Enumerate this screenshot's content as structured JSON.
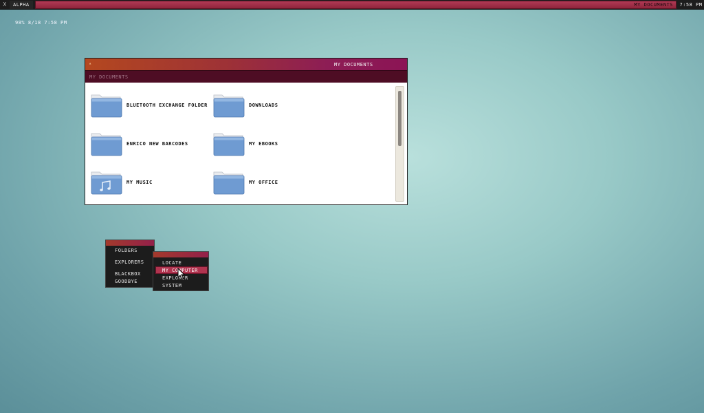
{
  "panel": {
    "close_glyph": "x",
    "workspace": "ALPHA",
    "active_task": "MY DOCUMENTS",
    "clock": "7:58 PM"
  },
  "desktop": {
    "status": "98% 8/18  7:58 pm"
  },
  "window": {
    "title": "MY DOCUMENTS",
    "button_glyph": "▴",
    "address": "MY DOCUMENTS",
    "items": [
      {
        "label": "BLUETOOTH EXCHANGE FOLDER",
        "icon": "folder-icon"
      },
      {
        "label": "DOWNLOADS",
        "icon": "folder-icon"
      },
      {
        "label": "ENRICO NEW BARCODES",
        "icon": "folder-icon"
      },
      {
        "label": "MY EBOOKS",
        "icon": "folder-icon"
      },
      {
        "label": "MY MUSIC",
        "icon": "music-folder-icon"
      },
      {
        "label": "MY OFFICE",
        "icon": "folder-icon"
      }
    ]
  },
  "menu": {
    "items": [
      "FOLDERS",
      "EXPLORERS",
      "BLACKBOX",
      "GOODBYE"
    ],
    "submenu": {
      "items": [
        "LOCATE",
        "MY COMPUTER",
        "EXPLORER",
        "SYSTEM"
      ],
      "selected": "MY COMPUTER"
    }
  },
  "colors": {
    "accent": "#b13a55",
    "titlebar_start": "#b4481f",
    "titlebar_end": "#8c1455",
    "address_bar": "#4e0d24",
    "folder_blue": "#6f9bd2"
  }
}
